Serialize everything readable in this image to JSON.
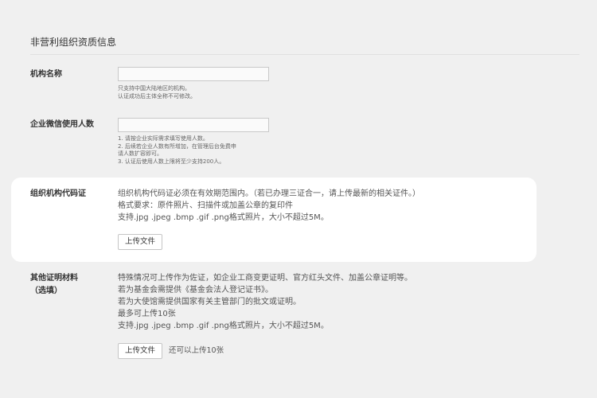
{
  "section": {
    "title": "非营利组织资质信息"
  },
  "org_name": {
    "label": "机构名称",
    "value": "",
    "hints": [
      "只支持中国大陆地区的机构。",
      "认证成功后主体全称不可修改。"
    ]
  },
  "wecom_users": {
    "label": "企业微信使用人数",
    "value": "",
    "hints": [
      "1. 请按企业实际需求填写使用人数。",
      "2. 后续若企业人数有所增加，在管理后台免费申",
      "请人数扩容即可。",
      "3. 认证后使用人数上限将至少支持200人。"
    ]
  },
  "org_code": {
    "label": "组织机构代码证",
    "lines": [
      "组织机构代码证必须在有效期范围内。（若已办理三证合一，请上传最新的相关证件。）",
      "格式要求：原件照片、扫描件或加盖公章的复印件",
      "支持.jpg .jpeg .bmp .gif .png格式照片，大小不超过5M。"
    ],
    "upload_label": "上传文件"
  },
  "other_docs": {
    "label_line1": "其他证明材料",
    "label_line2": "（选填）",
    "lines": [
      "特殊情况可上传作为佐证，如企业工商变更证明、官方红头文件、加盖公章证明等。",
      "若为基金会需提供《基金会法人登记证书》。",
      "若为大使馆需提供国家有关主管部门的批文或证明。",
      "最多可上传10张",
      "支持.jpg .jpeg .bmp .gif .png格式照片，大小不超过5M。"
    ],
    "upload_label": "上传文件",
    "upload_note": "还可以上传10张"
  }
}
